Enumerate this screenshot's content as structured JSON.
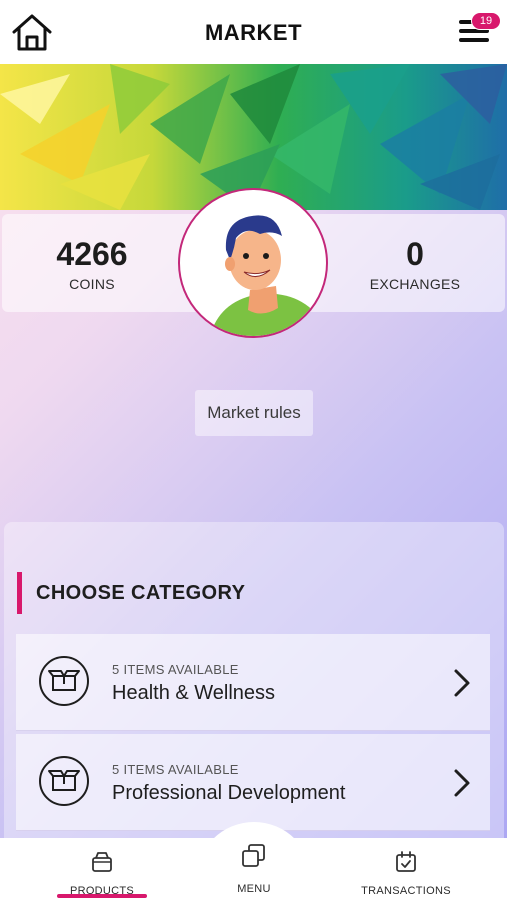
{
  "header": {
    "title": "MARKET",
    "home_icon": "home-icon",
    "menu_icon": "hamburger-menu-icon",
    "menu_badge": "19"
  },
  "colors": {
    "accent": "#d8186c",
    "avatar_border": "#c3287a"
  },
  "stats": {
    "coins": {
      "value": "4266",
      "label": "COINS"
    },
    "exchanges": {
      "value": "0",
      "label": "EXCHANGES"
    }
  },
  "market_rules_label": "Market rules",
  "categories": {
    "heading": "CHOOSE CATEGORY",
    "items": [
      {
        "count_text": "5 ITEMS AVAILABLE",
        "name": "Health & Wellness",
        "icon": "box-icon"
      },
      {
        "count_text": "5 ITEMS AVAILABLE",
        "name": "Professional Development",
        "icon": "box-icon"
      }
    ]
  },
  "bottom_nav": {
    "items": [
      {
        "label": "PRODUCTS",
        "icon": "bag-icon",
        "active": true
      },
      {
        "label": "MENU",
        "icon": "squares-icon",
        "active": false
      },
      {
        "label": "TRANSACTIONS",
        "icon": "calendar-check-icon",
        "active": false
      }
    ]
  }
}
